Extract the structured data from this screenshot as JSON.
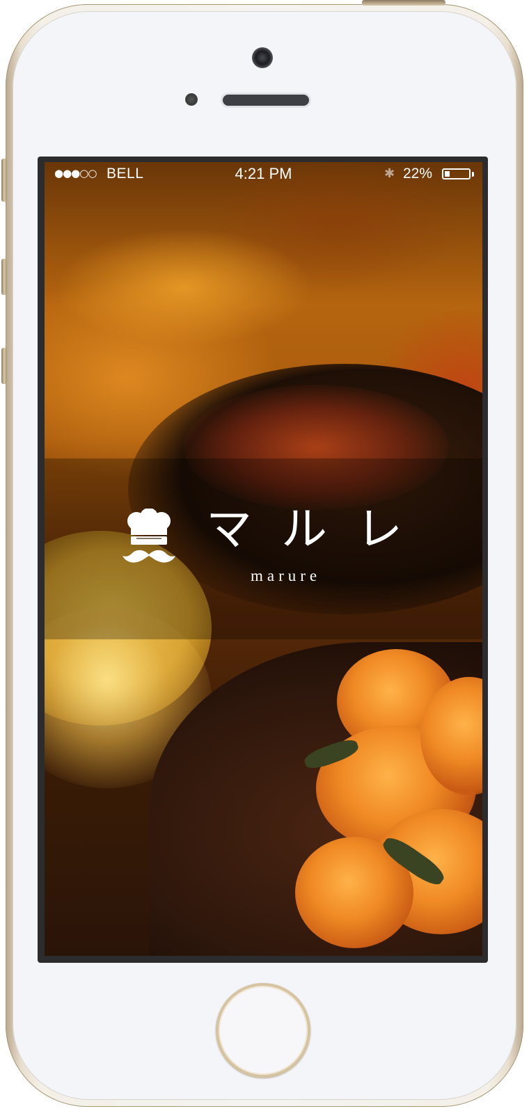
{
  "status_bar": {
    "signal": "●●●○○",
    "carrier": "BELL",
    "time": "4:21 PM",
    "bluetooth_icon": "bluetooth-icon",
    "battery_percent": "22%",
    "battery_level": 0.22
  },
  "splash": {
    "logo_icon": "chef-hat-mustache-icon",
    "title_jp": "マルレ",
    "title_en": "marure"
  },
  "device": {
    "model": "iPhone",
    "frame_color": "#f4f5f9",
    "trim_color": "#d6c3a0"
  }
}
